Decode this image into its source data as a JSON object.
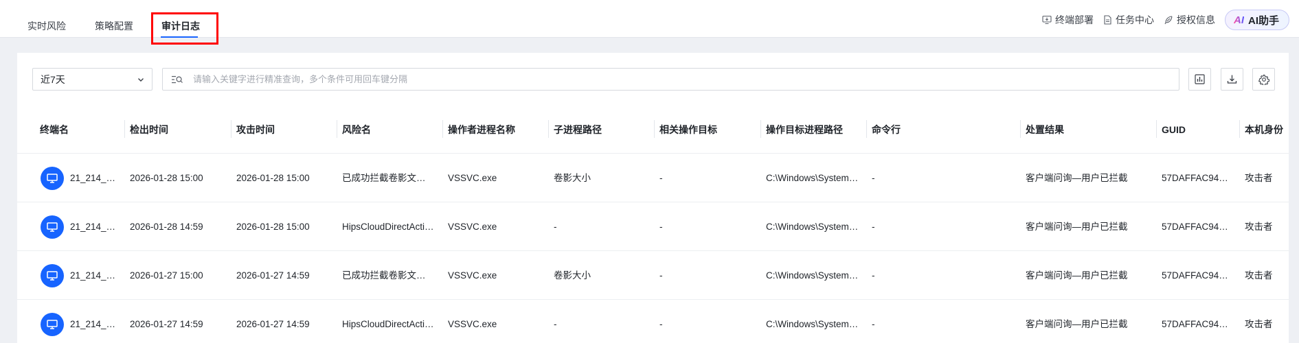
{
  "tabs": [
    {
      "label": "实时风险",
      "active": false
    },
    {
      "label": "策略配置",
      "active": false
    },
    {
      "label": "审计日志",
      "active": true
    }
  ],
  "top_actions": {
    "deploy": "终端部署",
    "tasks": "任务中心",
    "license": "授权信息",
    "ai_mark": "AI",
    "ai_label": "AI助手"
  },
  "filter": {
    "date_range": "近7天",
    "search_placeholder": "请输入关键字进行精准查询，多个条件可用回车键分隔"
  },
  "columns": [
    "终端名",
    "检出时间",
    "攻击时间",
    "风险名",
    "操作者进程名称",
    "子进程路径",
    "相关操作目标",
    "操作目标进程路径",
    "命令行",
    "处置结果",
    "GUID",
    "本机身份"
  ],
  "rows": [
    [
      "21_214_…",
      "2026-01-28 15:00",
      "2026-01-28 15:00",
      "已成功拦截卷影文…",
      "VSSVC.exe",
      "卷影大小",
      "-",
      "C:\\Windows\\System…",
      "-",
      "客户端问询—用户已拦截",
      "57DAFFAC94…",
      "攻击者"
    ],
    [
      "21_214_…",
      "2026-01-28 14:59",
      "2026-01-28 15:00",
      "HipsCloudDirectActi…",
      "VSSVC.exe",
      "-",
      "-",
      "C:\\Windows\\System…",
      "-",
      "客户端问询—用户已拦截",
      "57DAFFAC94…",
      "攻击者"
    ],
    [
      "21_214_…",
      "2026-01-27 15:00",
      "2026-01-27 14:59",
      "已成功拦截卷影文…",
      "VSSVC.exe",
      "卷影大小",
      "-",
      "C:\\Windows\\System…",
      "-",
      "客户端问询—用户已拦截",
      "57DAFFAC94…",
      "攻击者"
    ],
    [
      "21_214_…",
      "2026-01-27 14:59",
      "2026-01-27 14:59",
      "HipsCloudDirectActi…",
      "VSSVC.exe",
      "-",
      "-",
      "C:\\Windows\\System…",
      "-",
      "客户端问询—用户已拦截",
      "57DAFFAC94…",
      "攻击者"
    ]
  ],
  "colors": {
    "accent": "#1764ff",
    "highlight": "#ff0000"
  }
}
